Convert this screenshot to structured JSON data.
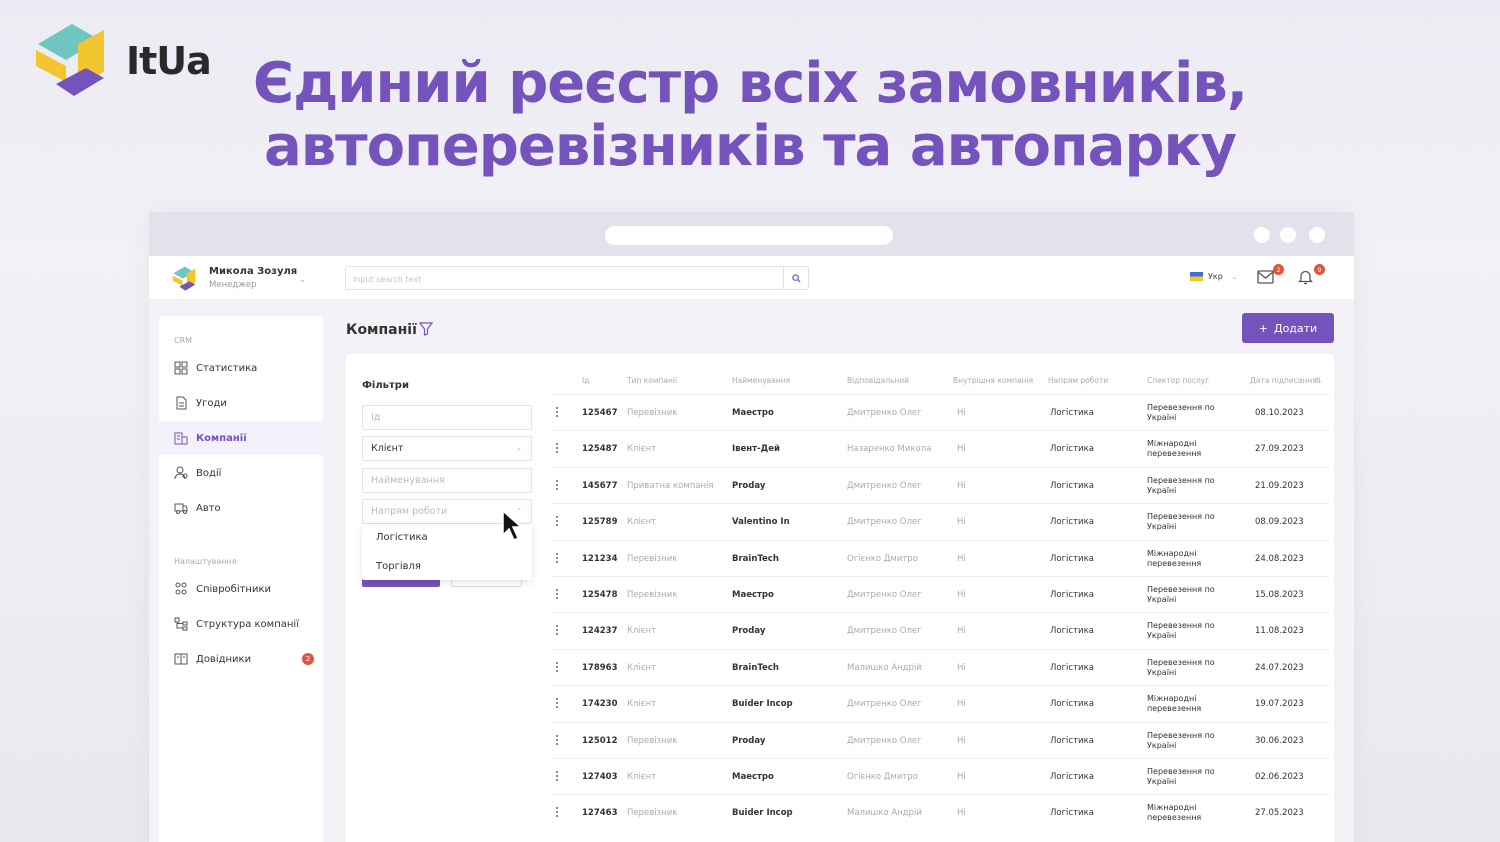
{
  "brand": {
    "name": "ItUa"
  },
  "headline": {
    "line1": "Єдиний реєстр всіх замовників,",
    "line2": "автоперевізників та автопарку"
  },
  "topbar": {
    "user_name": "Микола Зозуля",
    "user_role": "Менеджер",
    "search_placeholder": "Input search text",
    "lang": "Укр",
    "mail_count": "2",
    "notif_count": "9"
  },
  "sidebar": {
    "section_crm": "CRM",
    "section_settings": "Налаштування",
    "items": [
      {
        "label": "Статистика",
        "icon": "grid-icon"
      },
      {
        "label": "Угоди",
        "icon": "document-icon"
      },
      {
        "label": "Компанії",
        "icon": "building-icon",
        "active": true
      },
      {
        "label": "Водії",
        "icon": "driver-icon"
      },
      {
        "label": "Авто",
        "icon": "truck-icon"
      },
      {
        "label": "Співробітники",
        "icon": "team-icon"
      },
      {
        "label": "Структура компанії",
        "icon": "structure-icon"
      },
      {
        "label": "Довідники",
        "icon": "book-icon",
        "badge": "2"
      }
    ]
  },
  "page": {
    "title": "Компанії",
    "add_label": "Додати"
  },
  "filters": {
    "title": "Фільтри",
    "id_placeholder": "Ід",
    "type_value": "Клієнт",
    "name_placeholder": "Найменування",
    "direction_placeholder": "Напрям роботи",
    "direction_options": [
      "Логістика",
      "Торгівля"
    ]
  },
  "table": {
    "columns": [
      "Ід",
      "Тип компанії",
      "Найменування",
      "Відповідальний",
      "Внутрішня компанія",
      "Напрям роботи",
      "Спектор послуг",
      "Дата підписання"
    ],
    "rows": [
      {
        "id": "125467",
        "type": "Перевізник",
        "name": "Маестро",
        "resp": "Дмитренко Олег",
        "internal": "Ні",
        "direction": "Логістика",
        "service": "Перевезення по Україні",
        "date": "08.10.2023"
      },
      {
        "id": "125487",
        "type": "Клієнт",
        "name": "Івент-Дей",
        "resp": "Назаренко Микола",
        "internal": "Ні",
        "direction": "Логістика",
        "service": "Міжнародні перевезення",
        "date": "27.09.2023"
      },
      {
        "id": "145677",
        "type": "Приватна компанія",
        "name": "Proday",
        "resp": "Дмитренко Олег",
        "internal": "Ні",
        "direction": "Логістика",
        "service": "Перевезення по Україні",
        "date": "21.09.2023"
      },
      {
        "id": "125789",
        "type": "Клієнт",
        "name": "Valentino In",
        "resp": "Дмитренко Олег",
        "internal": "Ні",
        "direction": "Логістика",
        "service": "Перевезення по Україні",
        "date": "08.09.2023"
      },
      {
        "id": "121234",
        "type": "Перевізник",
        "name": "BrainTech",
        "resp": "Огієнко Дмитро",
        "internal": "Ні",
        "direction": "Логістика",
        "service": "Міжнародні перевезення",
        "date": "24.08.2023"
      },
      {
        "id": "125478",
        "type": "Перевізник",
        "name": "Маестро",
        "resp": "Дмитренко Олег",
        "internal": "Ні",
        "direction": "Логістика",
        "service": "Перевезення по Україні",
        "date": "15.08.2023"
      },
      {
        "id": "124237",
        "type": "Клієнт",
        "name": "Proday",
        "resp": "Дмитренко Олег",
        "internal": "Ні",
        "direction": "Логістика",
        "service": "Перевезення по Україні",
        "date": "11.08.2023"
      },
      {
        "id": "178963",
        "type": "Клієнт",
        "name": "BrainTech",
        "resp": "Малишко Андрій",
        "internal": "Ні",
        "direction": "Логістика",
        "service": "Перевезення по Україні",
        "date": "24.07.2023"
      },
      {
        "id": "174230",
        "type": "Клієнт",
        "name": "Buider Incop",
        "resp": "Дмитренко Олег",
        "internal": "Ні",
        "direction": "Логістика",
        "service": "Міжнародні перевезення",
        "date": "19.07.2023"
      },
      {
        "id": "125012",
        "type": "Перевізник",
        "name": "Proday",
        "resp": "Дмитренко Олег",
        "internal": "Ні",
        "direction": "Логістика",
        "service": "Перевезення по Україні",
        "date": "30.06.2023"
      },
      {
        "id": "127403",
        "type": "Клієнт",
        "name": "Маестро",
        "resp": "Огієнко Дмитро",
        "internal": "Ні",
        "direction": "Логістика",
        "service": "Перевезення по Україні",
        "date": "02.06.2023"
      },
      {
        "id": "127463",
        "type": "Перевізник",
        "name": "Buider Incop",
        "resp": "Малишко Андрій",
        "internal": "Ні",
        "direction": "Логістика",
        "service": "Міжнародні перевезення",
        "date": "27.05.2023"
      }
    ]
  },
  "colors": {
    "accent": "#7453bd",
    "badge": "#e5533f",
    "logo_yellow": "#f3c52e",
    "logo_teal": "#6fc5bf"
  }
}
